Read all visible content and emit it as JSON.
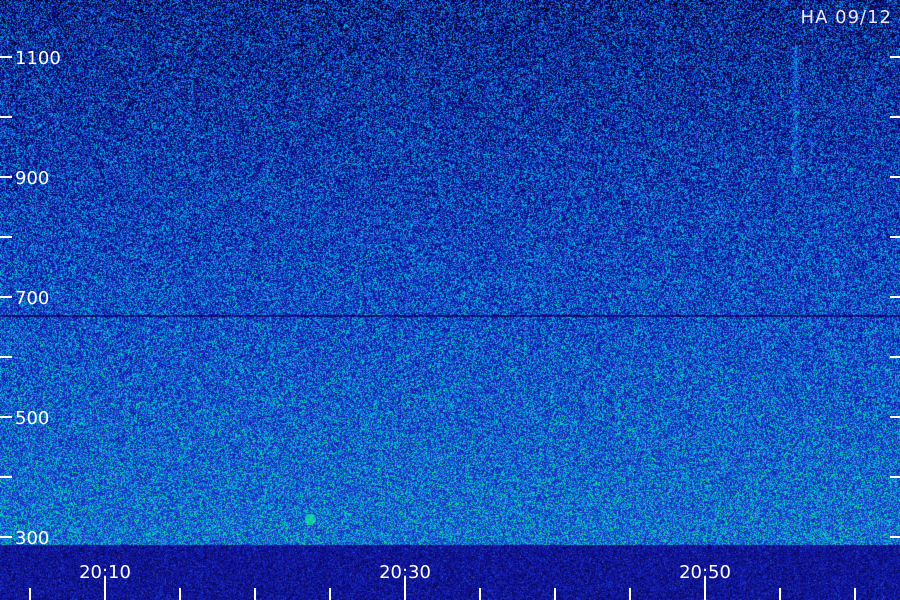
{
  "chart_data": {
    "type": "heatmap",
    "title": "",
    "stamp": "HA 09/12",
    "xlabel": "",
    "ylabel": "",
    "x_time_range": [
      "20:03",
      "21:03"
    ],
    "x_tick_labels": [
      "20:10",
      "20:30",
      "20:50"
    ],
    "x_minor_ticks": [
      "20:05",
      "20:10",
      "20:15",
      "20:20",
      "20:25",
      "20:30",
      "20:35",
      "20:40",
      "20:45",
      "20:50",
      "20:55",
      "21:00"
    ],
    "ylim": [
      300,
      1200
    ],
    "y_tick_values": [
      300,
      500,
      700,
      900,
      1100
    ],
    "y_minor_ticks": [
      400,
      600,
      800,
      1000,
      1200
    ],
    "features": [
      {
        "kind": "vertical streak",
        "time": "20:55",
        "y_range": [
          900,
          1120
        ]
      },
      {
        "kind": "horizontal line",
        "y": 670
      },
      {
        "kind": "bright spot",
        "time": "20:23",
        "y": 330
      }
    ],
    "colormap": [
      "#000010",
      "#1010a0",
      "#2040d0",
      "#1080e0",
      "#00c0e0",
      "#20e080"
    ],
    "intensity_trend": "brighter toward lower values"
  }
}
